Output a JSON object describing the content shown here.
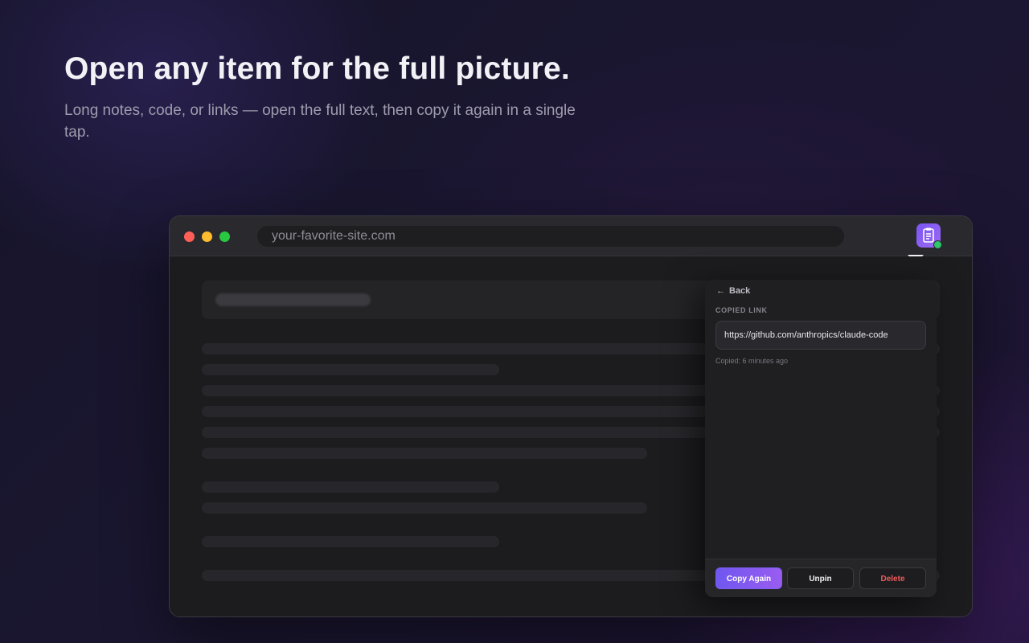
{
  "hero": {
    "title": "Open any item for the full picture.",
    "subtitle": "Long notes, code, or links — open the full text, then copy it again in a single tap."
  },
  "browser": {
    "url": "your-favorite-site.com",
    "extension_icon": "clipboard-check-icon"
  },
  "popup": {
    "back_label": "Back",
    "section_label": "COPIED LINK",
    "link": "https://github.com/anthropics/claude-code",
    "meta": "Copied: 6 minutes ago",
    "buttons": {
      "copy_again": "Copy Again",
      "unpin": "Unpin",
      "delete": "Delete"
    }
  },
  "colors": {
    "accent": "#7a55f2",
    "danger": "#f05a5a",
    "success": "#2ec76a"
  }
}
